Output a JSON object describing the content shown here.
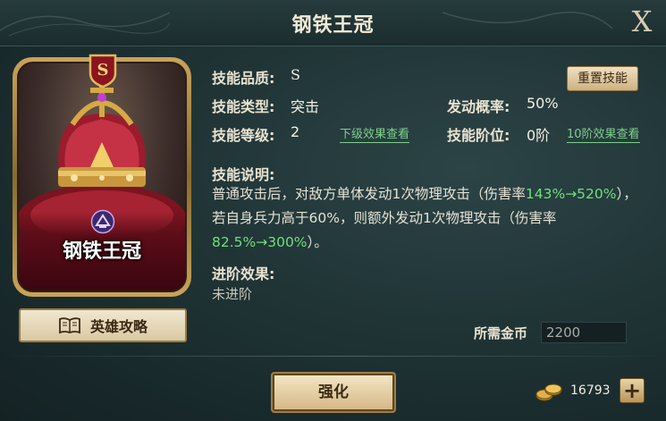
{
  "header": {
    "title": "钢铁王冠",
    "close_label": "X"
  },
  "card": {
    "name": "钢铁王冠",
    "grade_letter": "S",
    "art_icon": "crown-icon",
    "faction_icon": "faction-emblem-icon"
  },
  "guide_button": {
    "label": "英雄攻略",
    "icon": "book-icon"
  },
  "skill": {
    "quality_label": "技能品质:",
    "quality_value": "S",
    "type_label": "技能类型:",
    "type_value": "突击",
    "rate_label": "发动概率:",
    "rate_value": "50%",
    "level_label": "技能等级:",
    "level_value": "2",
    "lower_effect_link": "下级效果查看",
    "rank_label": "技能阶位:",
    "rank_value": "0阶",
    "rank10_link": "10阶效果查看",
    "reset_button": "重置技能"
  },
  "description": {
    "heading": "技能说明:",
    "part1": "普通攻击后，对敌方单体发动1次物理攻击（伤害率",
    "highlight1": "143%→520%",
    "part2": "），若自身兵力高于60%，则额外发动1次物理攻击（伤害率",
    "highlight2": "82.5%→300%",
    "part3": "）。"
  },
  "advance": {
    "heading": "进阶效果:",
    "value": "未进阶"
  },
  "cost": {
    "label": "所需金币",
    "value": "2200"
  },
  "upgrade_button": {
    "label": "强化"
  },
  "wallet": {
    "coins": "16793",
    "plus_label": "+",
    "icon": "gold-coins-icon"
  },
  "colors": {
    "accent_green": "#6fe07a",
    "panel_bg": "#1d3032",
    "button_gold": "#d4b684"
  }
}
